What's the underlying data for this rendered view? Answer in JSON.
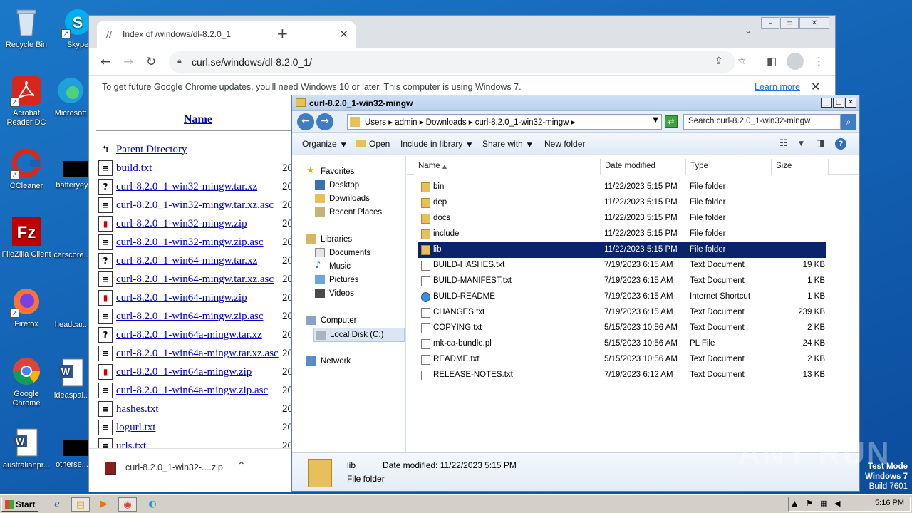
{
  "desktop": {
    "icons": [
      {
        "label": "Recycle Bin"
      },
      {
        "label": "Skype"
      },
      {
        "label": "Acrobat Reader DC"
      },
      {
        "label": "Microsoft"
      },
      {
        "label": "CCleaner"
      },
      {
        "label": "batteryey"
      },
      {
        "label": "FileZilla Client"
      },
      {
        "label": "carscore..."
      },
      {
        "label": "Firefox"
      },
      {
        "label": "headcar..."
      },
      {
        "label": "Google Chrome"
      },
      {
        "label": "ideaspai..."
      },
      {
        "label": "australianpr..."
      },
      {
        "label": "otherse..."
      }
    ],
    "watermark": "ANY RUN",
    "test_mode": {
      "line1": "Test Mode",
      "line2": "Windows 7",
      "line3": "Build 7601"
    }
  },
  "chrome": {
    "tab_title": "Index of /windows/dl-8.2.0_1",
    "url": "curl.se/windows/dl-8.2.0_1/",
    "infobar_message": "To get future Google Chrome updates, you'll need Windows 10 or later. This computer is using Windows 7.",
    "infobar_link": "Learn more",
    "page": {
      "column_name": "Name",
      "parent": "Parent Directory",
      "date_prefix": "20",
      "files": [
        {
          "name": "build.txt",
          "icon": "text"
        },
        {
          "name": "curl-8.2.0_1-win32-mingw.tar.xz",
          "icon": "unknown"
        },
        {
          "name": "curl-8.2.0_1-win32-mingw.tar.xz.asc",
          "icon": "text"
        },
        {
          "name": "curl-8.2.0_1-win32-mingw.zip",
          "icon": "archive"
        },
        {
          "name": "curl-8.2.0_1-win32-mingw.zip.asc",
          "icon": "text"
        },
        {
          "name": "curl-8.2.0_1-win64-mingw.tar.xz",
          "icon": "unknown"
        },
        {
          "name": "curl-8.2.0_1-win64-mingw.tar.xz.asc",
          "icon": "text"
        },
        {
          "name": "curl-8.2.0_1-win64-mingw.zip",
          "icon": "archive"
        },
        {
          "name": "curl-8.2.0_1-win64-mingw.zip.asc",
          "icon": "text"
        },
        {
          "name": "curl-8.2.0_1-win64a-mingw.tar.xz",
          "icon": "unknown"
        },
        {
          "name": "curl-8.2.0_1-win64a-mingw.tar.xz.asc",
          "icon": "text"
        },
        {
          "name": "curl-8.2.0_1-win64a-mingw.zip",
          "icon": "archive"
        },
        {
          "name": "curl-8.2.0_1-win64a-mingw.zip.asc",
          "icon": "text"
        },
        {
          "name": "hashes.txt",
          "icon": "text"
        },
        {
          "name": "logurl.txt",
          "icon": "text"
        },
        {
          "name": "urls.txt",
          "icon": "text"
        }
      ]
    },
    "download": {
      "name": "curl-8.2.0_1-win32-....zip"
    }
  },
  "explorer": {
    "title": "curl-8.2.0_1-win32-mingw",
    "breadcrumbs": "Users  ▸  admin  ▸  Downloads  ▸  curl-8.2.0_1-win32-mingw  ▸",
    "search_placeholder": "Search curl-8.2.0_1-win32-mingw",
    "commands": {
      "organize": "Organize",
      "open": "Open",
      "include_in_library": "Include in library",
      "share_with": "Share with",
      "new_folder": "New folder"
    },
    "nav": {
      "favorites": "Favorites",
      "desktop": "Desktop",
      "downloads": "Downloads",
      "recent_places": "Recent Places",
      "libraries": "Libraries",
      "documents": "Documents",
      "music": "Music",
      "pictures": "Pictures",
      "videos": "Videos",
      "computer": "Computer",
      "local_disk": "Local Disk (C:)",
      "network": "Network"
    },
    "columns": {
      "name": "Name",
      "date": "Date modified",
      "type": "Type",
      "size": "Size"
    },
    "rows": [
      {
        "name": "bin",
        "date": "11/22/2023 5:15 PM",
        "type": "File folder",
        "size": "",
        "icon": "folder"
      },
      {
        "name": "dep",
        "date": "11/22/2023 5:15 PM",
        "type": "File folder",
        "size": "",
        "icon": "folder"
      },
      {
        "name": "docs",
        "date": "11/22/2023 5:15 PM",
        "type": "File folder",
        "size": "",
        "icon": "folder"
      },
      {
        "name": "include",
        "date": "11/22/2023 5:15 PM",
        "type": "File folder",
        "size": "",
        "icon": "folder"
      },
      {
        "name": "lib",
        "date": "11/22/2023 5:15 PM",
        "type": "File folder",
        "size": "",
        "icon": "folder",
        "selected": true
      },
      {
        "name": "BUILD-HASHES.txt",
        "date": "7/19/2023 6:15 AM",
        "type": "Text Document",
        "size": "19 KB",
        "icon": "doc"
      },
      {
        "name": "BUILD-MANIFEST.txt",
        "date": "7/19/2023 6:15 AM",
        "type": "Text Document",
        "size": "1 KB",
        "icon": "doc"
      },
      {
        "name": "BUILD-README",
        "date": "7/19/2023 6:15 AM",
        "type": "Internet Shortcut",
        "size": "1 KB",
        "icon": "web"
      },
      {
        "name": "CHANGES.txt",
        "date": "7/19/2023 6:15 AM",
        "type": "Text Document",
        "size": "239 KB",
        "icon": "doc"
      },
      {
        "name": "COPYING.txt",
        "date": "5/15/2023 10:56 AM",
        "type": "Text Document",
        "size": "2 KB",
        "icon": "doc"
      },
      {
        "name": "mk-ca-bundle.pl",
        "date": "5/15/2023 10:56 AM",
        "type": "PL File",
        "size": "24 KB",
        "icon": "doc"
      },
      {
        "name": "README.txt",
        "date": "5/15/2023 10:56 AM",
        "type": "Text Document",
        "size": "2 KB",
        "icon": "doc"
      },
      {
        "name": "RELEASE-NOTES.txt",
        "date": "7/19/2023 6:12 AM",
        "type": "Text Document",
        "size": "13 KB",
        "icon": "doc"
      }
    ],
    "details": {
      "name": "lib",
      "modified": "Date modified:  11/22/2023 5:15 PM",
      "type": "File folder"
    }
  },
  "taskbar": {
    "start": "Start",
    "clock": "5:16 PM"
  }
}
